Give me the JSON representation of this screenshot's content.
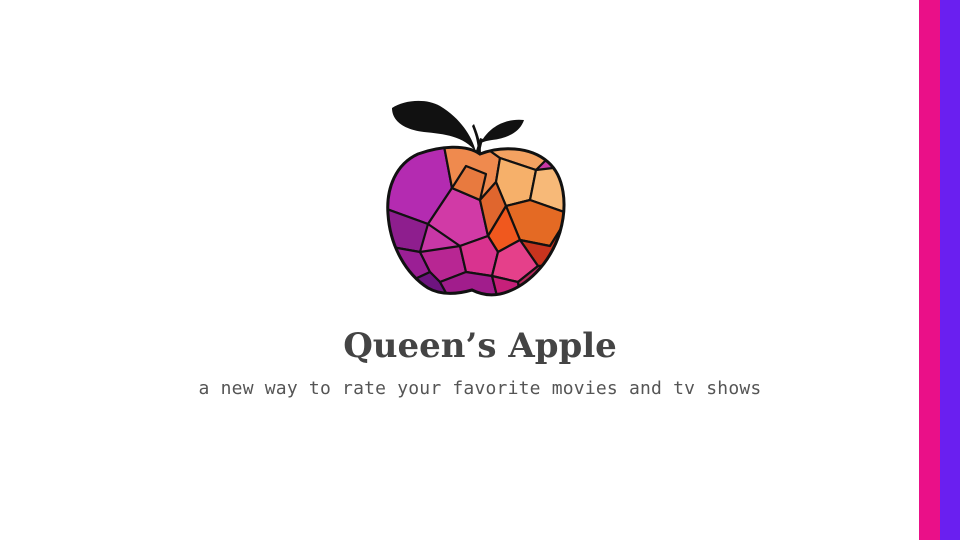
{
  "slide": {
    "title": "Queen’s Apple",
    "subtitle": "a new way to rate your favorite movies and tv shows"
  },
  "logo": {
    "icon": "stained-glass-apple-icon"
  },
  "colors": {
    "background": "#ffffff",
    "stripe_pink": "#ea1088",
    "stripe_purple": "#6a1ff0",
    "title_text": "#444444",
    "subtitle_text": "#555555"
  }
}
